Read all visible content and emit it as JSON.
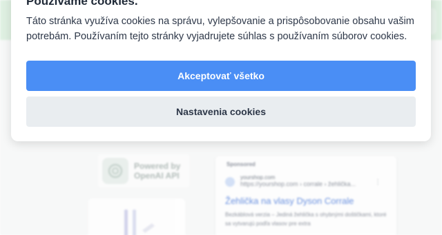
{
  "colors": {
    "accent": "#4a8ef5",
    "settings_bg": "#e9edf0",
    "header_bg": "#dff0e2"
  },
  "cookie": {
    "title": "Používame cookies.",
    "text": "Táto stránka využíva cookies na správu, vylepšovanie a prispôsobovanie obsahu vašim potrebám. Používaním tejto stránky vyjadrujete súhlas s používaním súborov cookies.",
    "accept_label": "Akceptovať všetko",
    "settings_label": "Nastavenia cookies"
  },
  "background": {
    "openai_badge": "Powered by\nOpenAI API",
    "ad": {
      "sponsored": "Sponsored",
      "domain": "yourshop.com",
      "path": "https://yourshop.com › corrale › žehlička...",
      "title": "Žehlička na vlasy Dyson Corrale",
      "description": "Bezkáblová verzia – Jediná žehlička s ohybnými doštičkami, ktoré sa vytvarujú podľa vlasov pre extra"
    }
  }
}
